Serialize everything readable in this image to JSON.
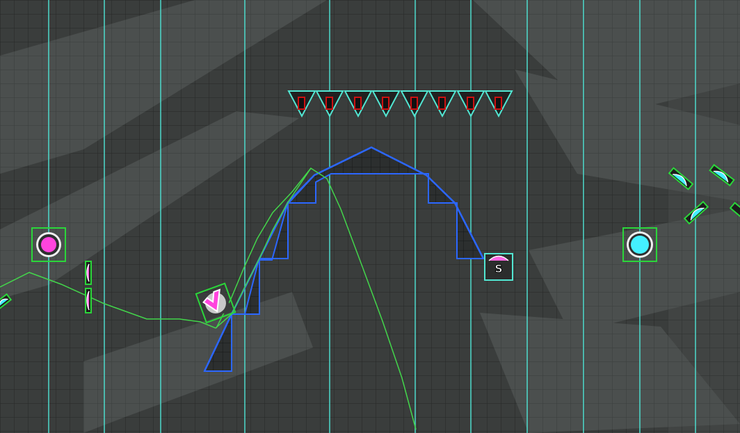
{
  "editor": {
    "mode": "build",
    "grid_visible": true,
    "show_paths": true,
    "colors": {
      "background": "#3c403e",
      "grid_line": "#252826",
      "guide_line": "#40e0d0",
      "ground_outline": "#1f6fff",
      "ground_fill": "#2a2d2c",
      "path_line": "#43d64b",
      "selection_outline": "#2bd63a",
      "hazard_outline": "#52e6d2",
      "hazard_core": "#cc0000",
      "orb_pink": "#ff44dd",
      "orb_cyan": "#44f0ff"
    }
  },
  "objects": {
    "jump_orb_pink": {
      "type": "jump-orb",
      "color": "pink"
    },
    "jump_orb_cyan": {
      "type": "jump-orb",
      "color": "cyan"
    },
    "ceiling_spikes": {
      "type": "spike",
      "count": 8
    },
    "speed_portal": {
      "type": "speed-portal",
      "label": "S"
    },
    "player_icon": {
      "type": "player-cube",
      "color": "magenta"
    },
    "gravity_pads": {
      "type": "pad",
      "count": 5
    }
  }
}
